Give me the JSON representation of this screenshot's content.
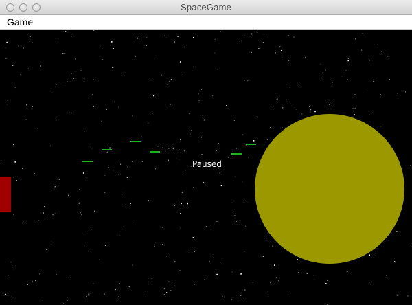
{
  "window": {
    "title": "SpaceGame"
  },
  "menubar": {
    "items": [
      {
        "label": "Game"
      }
    ]
  },
  "game": {
    "status": "Paused",
    "colors": {
      "background": "#000000",
      "planet": "#9c9900",
      "player_ship": "#a00000",
      "enemy": "#1db31d",
      "stars": "#ffffff"
    }
  }
}
